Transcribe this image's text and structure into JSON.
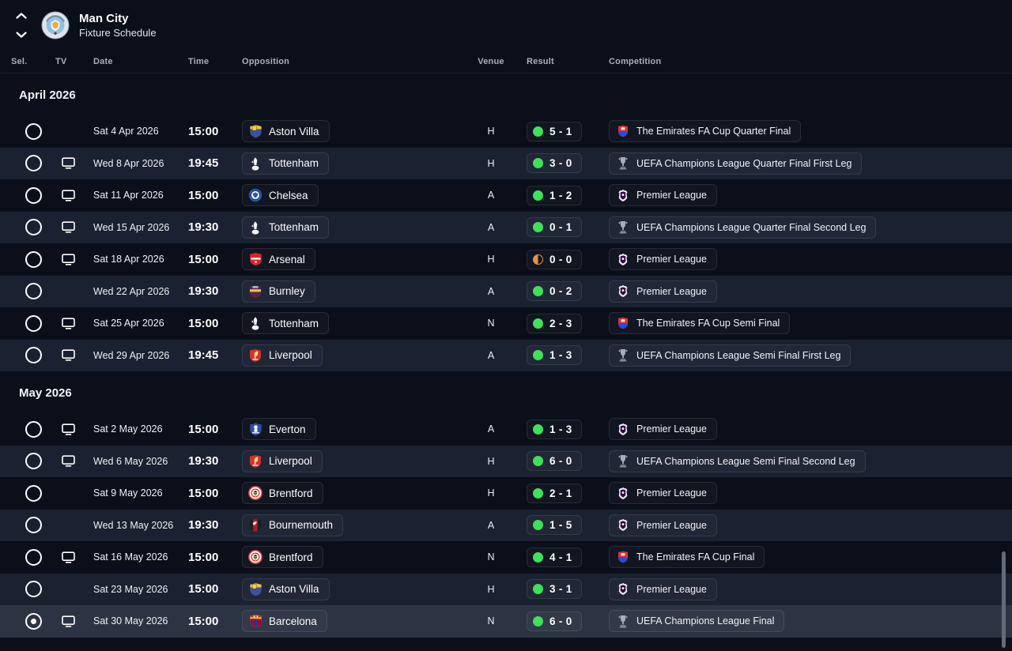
{
  "header": {
    "title": "Man City",
    "subtitle": "Fixture Schedule"
  },
  "columns": {
    "sel": "Sel.",
    "tv": "TV",
    "date": "Date",
    "time": "Time",
    "opposition": "Opposition",
    "venue": "Venue",
    "result": "Result",
    "competition": "Competition"
  },
  "colors": {
    "background": "#0a0f1a",
    "row_alt": "#1a2130",
    "row_selected": "#2c3343",
    "win_green": "#3fe05a",
    "draw_orange": "#e8923e"
  },
  "sections": [
    {
      "label": "April 2026",
      "rows": [
        {
          "selected": false,
          "tv": false,
          "date": "Sat 4 Apr 2026",
          "time": "15:00",
          "opposition": {
            "name": "Aston Villa",
            "badge": "aston-villa-badge"
          },
          "venue": "H",
          "result": {
            "score": "5 - 1",
            "outcome": "win"
          },
          "competition": {
            "name": "The Emirates FA Cup Quarter Final",
            "icon": "fa-cup-icon"
          }
        },
        {
          "selected": false,
          "tv": true,
          "date": "Wed 8 Apr 2026",
          "time": "19:45",
          "opposition": {
            "name": "Tottenham",
            "badge": "tottenham-badge"
          },
          "venue": "H",
          "result": {
            "score": "3 - 0",
            "outcome": "win"
          },
          "competition": {
            "name": "UEFA Champions League Quarter Final First Leg",
            "icon": "champions-league-icon"
          }
        },
        {
          "selected": false,
          "tv": true,
          "date": "Sat 11 Apr 2026",
          "time": "15:00",
          "opposition": {
            "name": "Chelsea",
            "badge": "chelsea-badge"
          },
          "venue": "A",
          "result": {
            "score": "1 - 2",
            "outcome": "win"
          },
          "competition": {
            "name": "Premier League",
            "icon": "premier-league-icon"
          }
        },
        {
          "selected": false,
          "tv": true,
          "date": "Wed 15 Apr 2026",
          "time": "19:30",
          "opposition": {
            "name": "Tottenham",
            "badge": "tottenham-badge"
          },
          "venue": "A",
          "result": {
            "score": "0 - 1",
            "outcome": "win"
          },
          "competition": {
            "name": "UEFA Champions League Quarter Final Second Leg",
            "icon": "champions-league-icon"
          }
        },
        {
          "selected": false,
          "tv": true,
          "date": "Sat 18 Apr 2026",
          "time": "15:00",
          "opposition": {
            "name": "Arsenal",
            "badge": "arsenal-badge"
          },
          "venue": "H",
          "result": {
            "score": "0 - 0",
            "outcome": "draw"
          },
          "competition": {
            "name": "Premier League",
            "icon": "premier-league-icon"
          }
        },
        {
          "selected": false,
          "tv": false,
          "date": "Wed 22 Apr 2026",
          "time": "19:30",
          "opposition": {
            "name": "Burnley",
            "badge": "burnley-badge"
          },
          "venue": "A",
          "result": {
            "score": "0 - 2",
            "outcome": "win"
          },
          "competition": {
            "name": "Premier League",
            "icon": "premier-league-icon"
          }
        },
        {
          "selected": false,
          "tv": true,
          "date": "Sat 25 Apr 2026",
          "time": "15:00",
          "opposition": {
            "name": "Tottenham",
            "badge": "tottenham-badge"
          },
          "venue": "N",
          "result": {
            "score": "2 - 3",
            "outcome": "win"
          },
          "competition": {
            "name": "The Emirates FA Cup Semi Final",
            "icon": "fa-cup-icon"
          }
        },
        {
          "selected": false,
          "tv": true,
          "date": "Wed 29 Apr 2026",
          "time": "19:45",
          "opposition": {
            "name": "Liverpool",
            "badge": "liverpool-badge"
          },
          "venue": "A",
          "result": {
            "score": "1 - 3",
            "outcome": "win"
          },
          "competition": {
            "name": "UEFA Champions League Semi Final First Leg",
            "icon": "champions-league-icon"
          }
        }
      ]
    },
    {
      "label": "May 2026",
      "rows": [
        {
          "selected": false,
          "tv": true,
          "date": "Sat 2 May 2026",
          "time": "15:00",
          "opposition": {
            "name": "Everton",
            "badge": "everton-badge"
          },
          "venue": "A",
          "result": {
            "score": "1 - 3",
            "outcome": "win"
          },
          "competition": {
            "name": "Premier League",
            "icon": "premier-league-icon"
          }
        },
        {
          "selected": false,
          "tv": true,
          "date": "Wed 6 May 2026",
          "time": "19:30",
          "opposition": {
            "name": "Liverpool",
            "badge": "liverpool-badge"
          },
          "venue": "H",
          "result": {
            "score": "6 - 0",
            "outcome": "win"
          },
          "competition": {
            "name": "UEFA Champions League Semi Final Second Leg",
            "icon": "champions-league-icon"
          }
        },
        {
          "selected": false,
          "tv": false,
          "date": "Sat 9 May 2026",
          "time": "15:00",
          "opposition": {
            "name": "Brentford",
            "badge": "brentford-badge"
          },
          "venue": "H",
          "result": {
            "score": "2 - 1",
            "outcome": "win"
          },
          "competition": {
            "name": "Premier League",
            "icon": "premier-league-icon"
          }
        },
        {
          "selected": false,
          "tv": false,
          "date": "Wed 13 May 2026",
          "time": "19:30",
          "opposition": {
            "name": "Bournemouth",
            "badge": "bournemouth-badge"
          },
          "venue": "A",
          "result": {
            "score": "1 - 5",
            "outcome": "win"
          },
          "competition": {
            "name": "Premier League",
            "icon": "premier-league-icon"
          }
        },
        {
          "selected": false,
          "tv": true,
          "date": "Sat 16 May 2026",
          "time": "15:00",
          "opposition": {
            "name": "Brentford",
            "badge": "brentford-badge"
          },
          "venue": "N",
          "result": {
            "score": "4 - 1",
            "outcome": "win"
          },
          "competition": {
            "name": "The Emirates FA Cup Final",
            "icon": "fa-cup-icon"
          }
        },
        {
          "selected": false,
          "tv": false,
          "date": "Sat 23 May 2026",
          "time": "15:00",
          "opposition": {
            "name": "Aston Villa",
            "badge": "aston-villa-badge"
          },
          "venue": "H",
          "result": {
            "score": "3 - 1",
            "outcome": "win"
          },
          "competition": {
            "name": "Premier League",
            "icon": "premier-league-icon"
          }
        },
        {
          "selected": true,
          "tv": true,
          "date": "Sat 30 May 2026",
          "time": "15:00",
          "opposition": {
            "name": "Barcelona",
            "badge": "barcelona-badge"
          },
          "venue": "N",
          "result": {
            "score": "6 - 0",
            "outcome": "win"
          },
          "competition": {
            "name": "UEFA Champions League Final",
            "icon": "champions-league-icon"
          }
        }
      ]
    }
  ]
}
